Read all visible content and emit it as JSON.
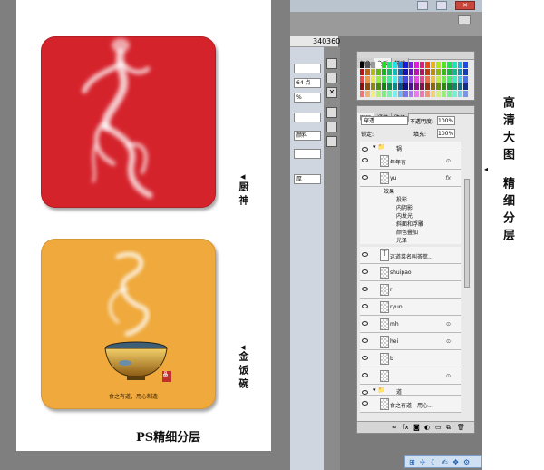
{
  "poster": {
    "caption_god": "厨神",
    "caption_bowl": "金饭碗",
    "bowl_text": "食之有道，用心制造",
    "seal": "品",
    "footer": "PS精细分层"
  },
  "photoshop": {
    "ruler": [
      "340",
      "360"
    ],
    "zoom_field": "64 点",
    "percent": "%",
    "opacity_label": "不透明度:",
    "opacity_value": "100%",
    "fill_label": "填充:",
    "fill_value": "100%",
    "lock_label": "锁定:",
    "blend_mode": "穿透",
    "side_label": "颜料",
    "style_label": "厚",
    "swatch_tabs": [
      "颜色",
      "色板",
      "样式"
    ],
    "layer_tabs": [
      "图层",
      "通道",
      "路径"
    ],
    "layers": [
      {
        "name": "锅",
        "kind": "group"
      },
      {
        "name": "年年有",
        "kind": "layer",
        "lock": "⊙"
      },
      {
        "name": "yu",
        "kind": "layer",
        "fx": "fx"
      },
      {
        "name": "这道菜名叫荟萃...",
        "kind": "text"
      },
      {
        "name": "shuipao",
        "kind": "layer"
      },
      {
        "name": "r",
        "kind": "layer"
      },
      {
        "name": "ryun",
        "kind": "layer"
      },
      {
        "name": "mh",
        "kind": "layer",
        "lock": "⊙"
      },
      {
        "name": "hei",
        "kind": "layer",
        "lock": "⊙"
      },
      {
        "name": "b",
        "kind": "layer"
      },
      {
        "name": "",
        "kind": "layer",
        "lock": "⊙"
      },
      {
        "name": "道",
        "kind": "group"
      },
      {
        "name": "食之有道，用心...",
        "kind": "layer"
      }
    ],
    "effects_header": "效果",
    "effects": [
      "投影",
      "内阴影",
      "内发光",
      "斜面和浮雕",
      "颜色叠加",
      "光泽"
    ]
  },
  "side_title": {
    "line1": "高清大图",
    "line2": "精细分层"
  },
  "colors": {
    "red_tile": "#d5232c",
    "gold_tile": "#efa93c"
  }
}
